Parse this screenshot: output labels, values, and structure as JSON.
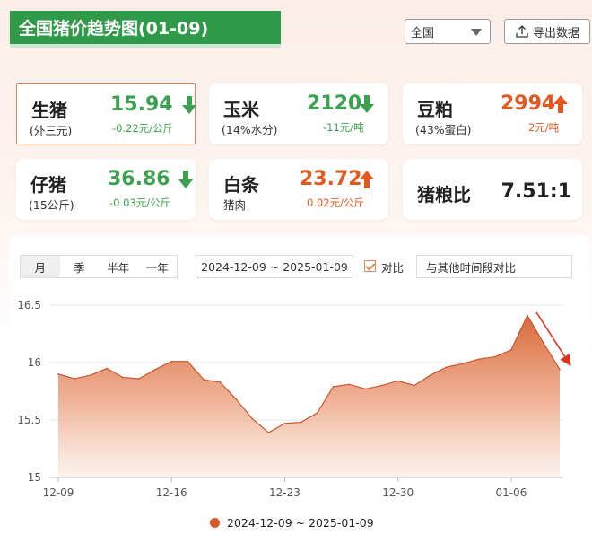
{
  "header": {
    "title": "全国猪价趋势图(01-09)",
    "region": "全国",
    "export_label": "导出数据"
  },
  "cards": {
    "pig": {
      "name": "生猪",
      "sub": "(外三元)",
      "price": "15.94",
      "delta": "-0.22元/公斤",
      "trend": "down"
    },
    "corn": {
      "name": "玉米",
      "sub": "(14%水分)",
      "price": "2120",
      "delta": "-11元/吨",
      "trend": "down"
    },
    "soymeal": {
      "name": "豆粕",
      "sub": "(43%蛋白)",
      "price": "2994",
      "delta": "2元/吨",
      "trend": "up"
    },
    "piglet": {
      "name": "仔猪",
      "sub": "(15公斤)",
      "price": "36.86",
      "delta": "-0.03元/公斤",
      "trend": "down"
    },
    "carcass": {
      "name": "白条",
      "sub": "猪肉",
      "price": "23.72",
      "delta": "0.02元/公斤",
      "trend": "up"
    },
    "ratio": {
      "name": "猪粮比",
      "value": "7.51:1"
    }
  },
  "controls": {
    "tabs": [
      "月",
      "季",
      "半年",
      "一年"
    ],
    "date_range": "2024-12-09 ~ 2025-01-09",
    "compare_label": "对比",
    "compare_placeholder": "与其他时间段对比"
  },
  "colors": {
    "up": "#e2581f",
    "down": "#3aa24f",
    "series": "#d65a27",
    "brand": "#2f9a47"
  },
  "chart_data": {
    "type": "area",
    "x": [
      "12-09",
      "12-10",
      "12-11",
      "12-12",
      "12-13",
      "12-14",
      "12-15",
      "12-16",
      "12-17",
      "12-18",
      "12-19",
      "12-20",
      "12-21",
      "12-22",
      "12-23",
      "12-24",
      "12-25",
      "12-26",
      "12-27",
      "12-28",
      "12-29",
      "12-30",
      "12-31",
      "01-01",
      "01-02",
      "01-03",
      "01-04",
      "01-05",
      "01-06",
      "01-07",
      "01-08",
      "01-09"
    ],
    "series": [
      {
        "name": "2024-12-09 ~ 2025-01-09",
        "values": [
          15.9,
          15.86,
          15.89,
          15.95,
          15.87,
          15.86,
          15.94,
          16.01,
          16.01,
          15.85,
          15.83,
          15.68,
          15.51,
          15.39,
          15.47,
          15.48,
          15.56,
          15.79,
          15.81,
          15.77,
          15.8,
          15.84,
          15.8,
          15.89,
          15.96,
          15.99,
          16.03,
          16.05,
          16.11,
          16.41,
          16.17,
          15.94
        ]
      }
    ],
    "xticks": [
      "12-09",
      "12-16",
      "12-23",
      "12-30",
      "01-06"
    ],
    "yticks": [
      "15",
      "15.5",
      "16",
      "16.5"
    ],
    "ylim": [
      15,
      16.6
    ],
    "legend": "bottom",
    "grid": true
  }
}
